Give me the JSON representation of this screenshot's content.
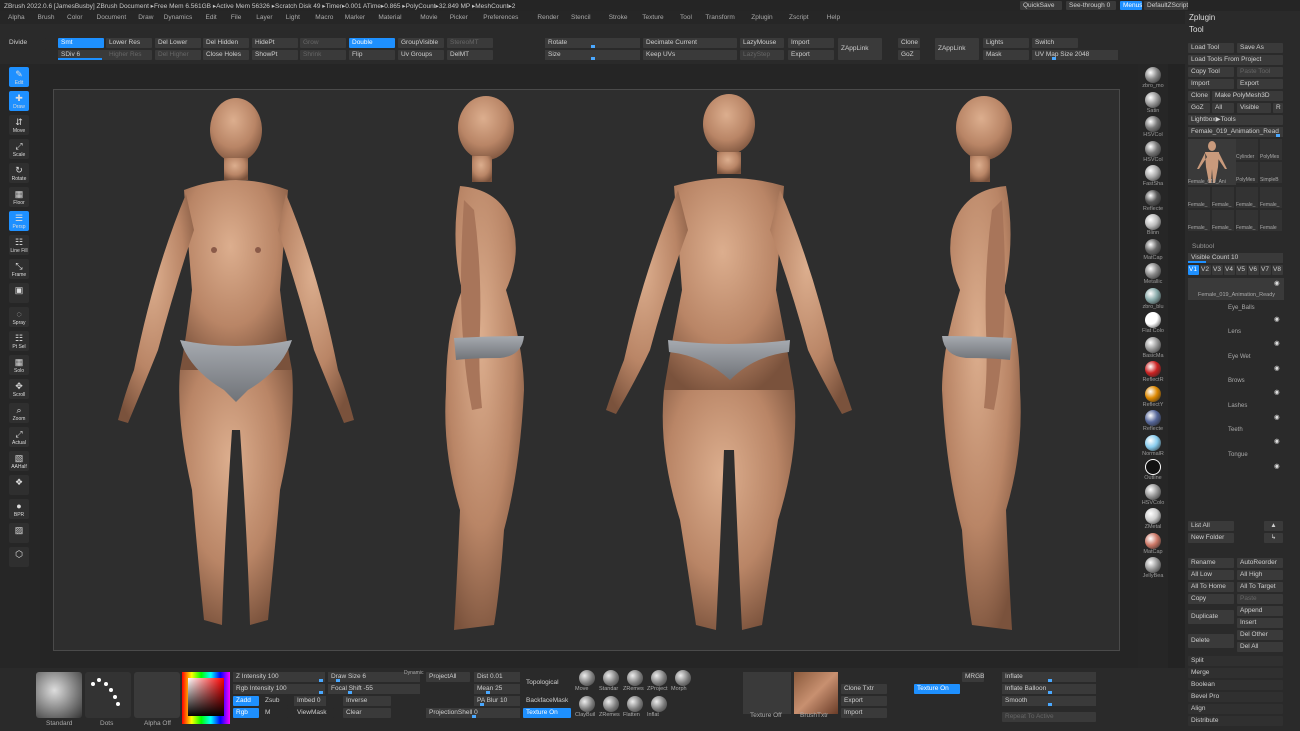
{
  "title_bar": {
    "text": "ZBrush 2022.0.6 [JamesBusby]   ZBrush Document      ▸Free Mem 6.561GB ▸Active Mem 56326 ▸Scratch Disk 49 ▸Timer▸0.001 ATime▸0.865 ▸PolyCount▸32.849 MP ▸MeshCount▸2",
    "quicksave": "QuickSave",
    "seethrough": "See-through  0",
    "menus": "Menus",
    "script": "DefaultZScript"
  },
  "menu": [
    "Alpha",
    "Brush",
    "Color",
    "Document",
    "Draw",
    "Dynamics",
    "Edit",
    "File",
    "Layer",
    "Light",
    "Macro",
    "Marker",
    "Material",
    "Movie",
    "Picker",
    "Preferences",
    "Render",
    "Stencil",
    "Stroke",
    "Texture",
    "Tool",
    "Transform",
    "Zplugin",
    "Zscript",
    "Help"
  ],
  "top": {
    "divide": "Divide",
    "smt": "Smt",
    "sdiv": "SDiv 6",
    "lower_res": "Lower Res",
    "higher_res": "Higher Res",
    "del_lower": "Del Lower",
    "del_higher": "Del Higher",
    "del_hidden": "Del Hidden",
    "close_holes": "Close Holes",
    "hidept": "HidePt",
    "showpt": "ShowPt",
    "grow": "Grow",
    "shrink": "Shrink",
    "double": "Double",
    "flip": "Flip",
    "groupvisible": "GroupVisible",
    "uvgroups": "Uv Groups",
    "stereo": "StereoMT",
    "delmt": "DelMT",
    "rotate": "Rotate",
    "size": "Size",
    "decimate": "Decimate Current",
    "keepuvs": "Keep UVs",
    "lazymouse": "LazyMouse",
    "lazystep": "LazyStep",
    "import": "Import",
    "export": "Export",
    "zapplink": "ZAppLink",
    "clone": "Clone",
    "goz": "GoZ",
    "zapplink2": "ZAppLink",
    "lights": "Lights",
    "mask": "Mask",
    "switch": "Switch",
    "uvmap": "UV Map Size 2048"
  },
  "left_tools": [
    {
      "g": "✎",
      "t": "Edit"
    },
    {
      "g": "✚",
      "t": "Draw"
    },
    {
      "g": "⇵",
      "t": "Move"
    },
    {
      "g": "⤢",
      "t": "Scale"
    },
    {
      "g": "↻",
      "t": "Rotate"
    },
    {
      "g": "▦",
      "t": "Floor"
    },
    {
      "g": "☰",
      "t": "Persp"
    },
    {
      "g": "☷",
      "t": "Line Fill"
    },
    {
      "g": "⤡",
      "t": "Frame"
    },
    {
      "g": "▣",
      "t": ""
    },
    {
      "g": "◌",
      "t": "Spray"
    },
    {
      "g": "☷",
      "t": "Pt Sel"
    },
    {
      "g": "▦",
      "t": "Solo"
    },
    {
      "g": "✥",
      "t": "Scroll"
    },
    {
      "g": "⌕",
      "t": "Zoom"
    },
    {
      "g": "⤢",
      "t": "Actual"
    },
    {
      "g": "▧",
      "t": "AAHalf"
    },
    {
      "g": "❖",
      "t": ""
    },
    {
      "g": "●",
      "t": "BPR"
    },
    {
      "g": "▨",
      "t": ""
    },
    {
      "g": "⬡",
      "t": ""
    }
  ],
  "right_mats": [
    "zbro_mo",
    "Satin",
    "HSVCol",
    "HSVCol",
    "FastSha",
    "Reflecte",
    "Blinn",
    "MatCap",
    "Metallic",
    "zbro_blu",
    "Flat Colo",
    "BasicMa",
    "ReflectR",
    "ReflectY",
    "Reflecte",
    "NormalR",
    "Outline",
    "HSVColo",
    "ZMetal",
    "MatCap",
    "JellyBea"
  ],
  "panel": {
    "zplugin": "Zplugin",
    "tool": "Tool",
    "load_tool": "Load Tool",
    "save_as": "Save As",
    "load_from_project": "Load Tools From Project",
    "copy_tool": "Copy Tool",
    "paste_tool": "Paste Tool",
    "import": "Import",
    "export": "Export",
    "clone": "Clone",
    "make_polymesh": "Make PolyMesh3D",
    "goz": "GoZ",
    "all": "All",
    "visible": "Visible",
    "r": "R",
    "lightbox": "Lightbox▶Tools",
    "current_tool": "Female_019_Animation_Read",
    "thumbs": [
      "Female_019_Ani",
      "Cylinder",
      "PolyMes",
      "PolyMes",
      "SimpleB",
      "Female_",
      "Female_",
      "Female_",
      "Female_",
      "Female_",
      "Female_",
      "Female_",
      "Female"
    ],
    "subtool": "Subtool",
    "visible_count": "Visible Count 10",
    "versions": [
      "V1",
      "V2",
      "V3",
      "V4",
      "V5",
      "V6",
      "V7",
      "V8"
    ],
    "subtools": [
      "Female_019_Animation_Ready",
      "Eye_Balls",
      "Lens",
      "Eye Wet",
      "Brows",
      "Lashes",
      "Teeth",
      "Tongue"
    ],
    "list_all": "List All",
    "new_folder": "New Folder",
    "rename": "Rename",
    "autoreorder": "AutoReorder",
    "all_low": "All Low",
    "all_high": "All High",
    "all_to_home": "All To Home",
    "all_to_target": "All To Target",
    "copy": "Copy",
    "paste": "Paste",
    "append": "Append",
    "duplicate": "Duplicate",
    "insert": "Insert",
    "delete": "Delete",
    "del_other": "Del Other",
    "del_all": "Del All",
    "split": "Split",
    "merge": "Merge",
    "boolean": "Boolean",
    "bevel_pro": "Bevel Pro",
    "align": "Align",
    "distribute": "Distribute"
  },
  "bottom": {
    "standard": "Standard",
    "dots": "Dots",
    "alpha_off": "Alpha Off",
    "z_intensity": "Z Intensity 100",
    "rgb_intensity": "Rgb Intensity 100",
    "zadd": "Zadd",
    "zsub": "Zsub",
    "rgb": "Rgb",
    "m": "M",
    "imbed": "Imbed 0",
    "viewmask": "ViewMask",
    "draw_size": "Draw Size 6",
    "dynamic": "Dynamic",
    "focal_shift": "Focal Shift -55",
    "inverse": "Inverse",
    "clear": "Clear",
    "projectall": "ProjectAll",
    "dist": "Dist 0.01",
    "mean": "Mean 25",
    "pa_blur": "PA Blur 10",
    "projectionshell": "ProjectionShell 0",
    "topological": "Topological",
    "backfacemask": "BackfaceMask",
    "texture_on": "Texture On",
    "brushes": [
      "Move",
      "Standar",
      "ZRemes",
      "ZProject",
      "Morph",
      "ClayBuil",
      "ZRemes",
      "Flatten",
      "Inflat"
    ],
    "texture_off": "Texture Off",
    "brushtxt": "BrushTxtr",
    "clone_txtr": "Clone Txtr",
    "export": "Export",
    "import": "Import",
    "texture_on2": "Texture On",
    "mrgb": "MRGB",
    "inflate": "Inflate",
    "inflate_balloon": "Inflate Balloon",
    "smooth": "Smooth",
    "repeat": "Repeat To Active"
  },
  "colors": {
    "accent": "#1e90ff",
    "bg": "#1e1e1e",
    "canvas": "#2c2c2c",
    "skin": "#c99a7c"
  }
}
